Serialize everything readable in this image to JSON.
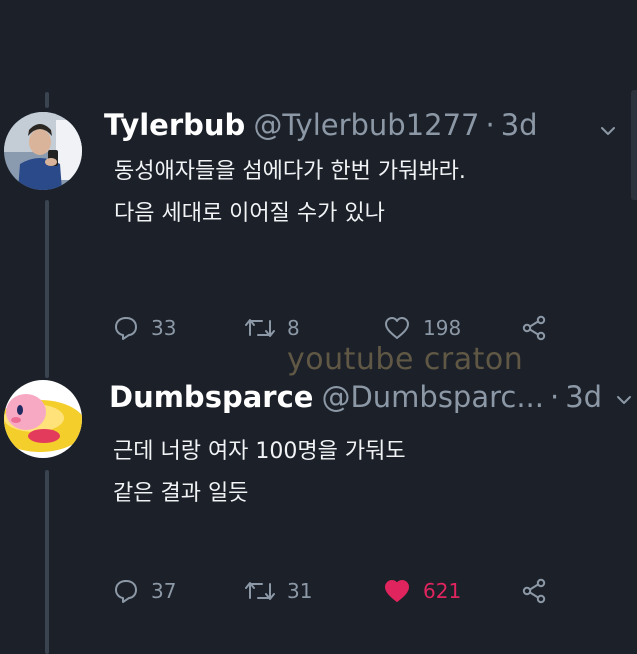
{
  "tweets": [
    {
      "display_name": "Tylerbub",
      "handle": "@Tylerbub1277",
      "separator": "·",
      "time": "3d",
      "text_lines": [
        "동성애자들을 섬에다가 한번 가둬봐라.",
        "다음 세대로 이어질 수가 있나"
      ],
      "replies": "33",
      "retweets": "8",
      "likes": "198",
      "liked": false
    },
    {
      "display_name": "Dumbsparce",
      "handle": "@Dumbsparc...",
      "separator": "·",
      "time": "3d",
      "text_lines": [
        "근데 너랑 여자 100명을 가둬도",
        "같은 결과 일듯"
      ],
      "replies": "37",
      "retweets": "31",
      "likes": "621",
      "liked": true
    }
  ],
  "watermark": "youtube craton",
  "colors": {
    "background": "#1b2029",
    "muted": "#8c98a6",
    "like_active": "#e0245e",
    "thread_line": "#3a4350"
  },
  "icons": [
    "chevron-down-icon",
    "reply-icon",
    "retweet-icon",
    "like-icon",
    "share-icon"
  ]
}
